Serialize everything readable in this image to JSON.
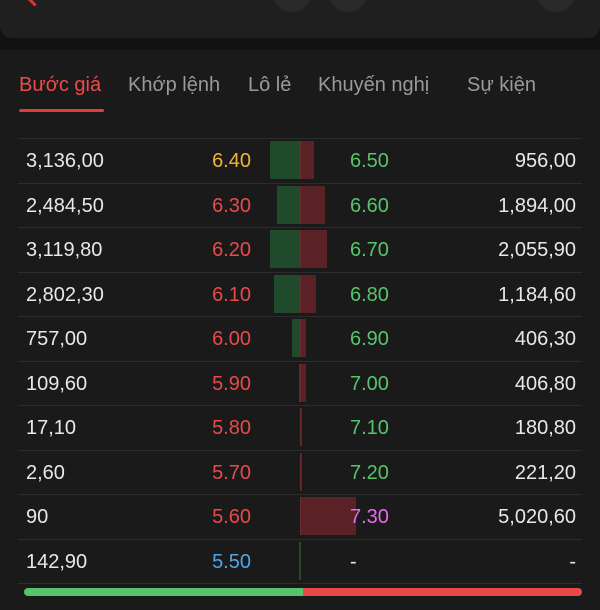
{
  "colors": {
    "up": "#56c46a",
    "down": "#e84a4a",
    "ceiling": "#e56ae8",
    "floor": "#4da7e8",
    "reference": "#f0b43a",
    "accent": "#e23b3b"
  },
  "tabs": [
    {
      "label": "Bước giá",
      "active": true
    },
    {
      "label": "Khớp lệnh",
      "active": false
    },
    {
      "label": "Lô lẻ",
      "active": false
    },
    {
      "label": "Khuyến nghị",
      "active": false
    },
    {
      "label": "Sự kiện",
      "active": false
    }
  ],
  "rows": [
    {
      "buy_vol": "3,136,00",
      "bid": "6.40",
      "bid_color": "reference",
      "ask": "6.50",
      "ask_color": "up",
      "sell_vol": "956,00",
      "buy_share": 0.82,
      "sell_share": 0.25
    },
    {
      "buy_vol": "2,484,50",
      "bid": "6.30",
      "bid_color": "down",
      "ask": "6.60",
      "ask_color": "up",
      "sell_vol": "1,894,00",
      "buy_share": 0.65,
      "sell_share": 0.45
    },
    {
      "buy_vol": "3,119,80",
      "bid": "6.20",
      "bid_color": "down",
      "ask": "6.70",
      "ask_color": "up",
      "sell_vol": "2,055,90",
      "buy_share": 0.82,
      "sell_share": 0.48
    },
    {
      "buy_vol": "2,802,30",
      "bid": "6.10",
      "bid_color": "down",
      "ask": "6.80",
      "ask_color": "up",
      "sell_vol": "1,184,60",
      "buy_share": 0.72,
      "sell_share": 0.28
    },
    {
      "buy_vol": "757,00",
      "bid": "6.00",
      "bid_color": "down",
      "ask": "6.90",
      "ask_color": "up",
      "sell_vol": "406,30",
      "buy_share": 0.22,
      "sell_share": 0.1
    },
    {
      "buy_vol": "109,60",
      "bid": "5.90",
      "bid_color": "down",
      "ask": "7.00",
      "ask_color": "up",
      "sell_vol": "406,80",
      "buy_share": 0.03,
      "sell_share": 0.1
    },
    {
      "buy_vol": "17,10",
      "bid": "5.80",
      "bid_color": "down",
      "ask": "7.10",
      "ask_color": "up",
      "sell_vol": "180,80",
      "buy_share": 0.0,
      "sell_share": 0.03
    },
    {
      "buy_vol": "2,60",
      "bid": "5.70",
      "bid_color": "down",
      "ask": "7.20",
      "ask_color": "up",
      "sell_vol": "221,20",
      "buy_share": 0.0,
      "sell_share": 0.03
    },
    {
      "buy_vol": "90",
      "bid": "5.60",
      "bid_color": "down",
      "ask": "7.30",
      "ask_color": "ceiling",
      "sell_vol": "5,020,60",
      "buy_share": 0.0,
      "sell_share": 1.0
    },
    {
      "buy_vol": "142,90",
      "bid": "5.50",
      "bid_color": "floor",
      "ask": "-",
      "ask_color": "neutral",
      "sell_vol": "-",
      "buy_share": 0.02,
      "sell_share": 0.0
    }
  ],
  "footer": {
    "buy_ratio": 0.5
  }
}
